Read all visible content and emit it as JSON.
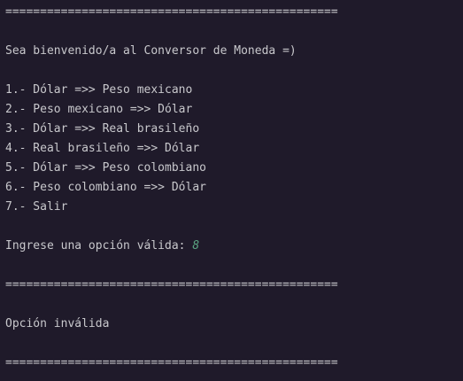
{
  "console": {
    "separator": "================================================",
    "welcome": "Sea bienvenido/a al Conversor de Moneda =)",
    "menu": [
      "1.- Dólar =>> Peso mexicano",
      "2.- Peso mexicano =>> Dólar",
      "3.- Dólar =>> Real brasileño",
      "4.- Real brasileño =>> Dólar",
      "5.- Dólar =>> Peso colombiano",
      "6.- Peso colombiano =>> Dólar",
      "7.- Salir"
    ],
    "prompt": "Ingrese una opción válida: ",
    "input_value": "8",
    "error": "Opción inválida",
    "colors": {
      "background": "#1f1a2a",
      "text": "#c8c8cc",
      "input": "#5aa381"
    }
  }
}
